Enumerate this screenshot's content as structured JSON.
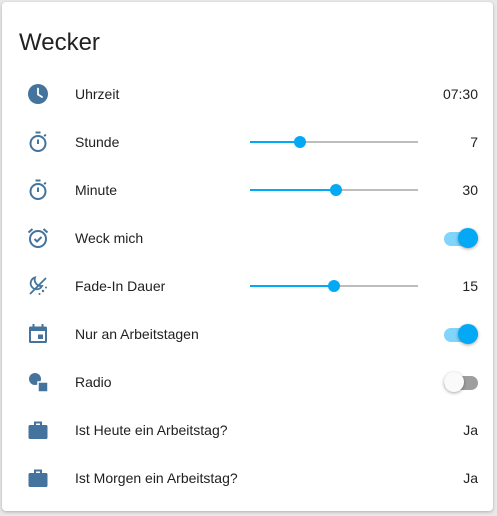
{
  "card": {
    "title": "Wecker"
  },
  "colors": {
    "icon": "#44739e",
    "accent": "#03a9f4",
    "track": "#bdbdbd"
  },
  "rows": [
    {
      "icon": "clock-icon",
      "label": "Uhrzeit",
      "value": "07:30"
    },
    {
      "icon": "timer-icon",
      "label": "Stunde",
      "value": "7",
      "slider_fraction": 0.3
    },
    {
      "icon": "timer-icon",
      "label": "Minute",
      "value": "30",
      "slider_fraction": 0.51
    },
    {
      "icon": "alarm-check-icon",
      "label": "Weck mich",
      "toggle_on": true
    },
    {
      "icon": "weather-night-partly-icon",
      "label": "Fade-In Dauer",
      "value": "15",
      "slider_fraction": 0.5
    },
    {
      "icon": "calendar-icon",
      "label": "Nur an Arbeitstagen",
      "toggle_on": true
    },
    {
      "icon": "shapes-icon",
      "label": "Radio",
      "toggle_on": false
    },
    {
      "icon": "briefcase-icon",
      "label": "Ist Heute ein Arbeitstag?",
      "value": "Ja"
    },
    {
      "icon": "briefcase-icon",
      "label": "Ist Morgen ein Arbeitstag?",
      "value": "Ja"
    }
  ]
}
